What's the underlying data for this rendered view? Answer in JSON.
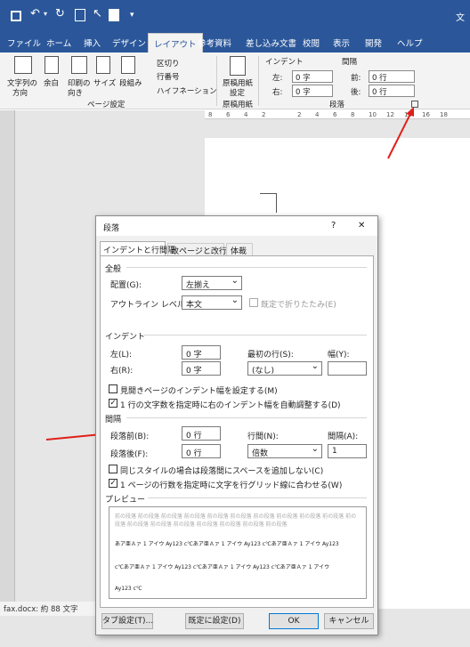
{
  "titlebar": {
    "doc_title_partial": "文"
  },
  "tabs": [
    {
      "label": "ファイル"
    },
    {
      "label": "ホーム"
    },
    {
      "label": "挿入"
    },
    {
      "label": "デザイン"
    },
    {
      "label": "レイアウト"
    },
    {
      "label": "参考資料"
    },
    {
      "label": "差し込み文書"
    },
    {
      "label": "校閲"
    },
    {
      "label": "表示"
    },
    {
      "label": "開発"
    },
    {
      "label": "ヘルプ"
    }
  ],
  "ribbon": {
    "text_direction_l1": "文字列の",
    "text_direction_l2": "方向",
    "margins": "余白",
    "orientation_l1": "印刷の",
    "orientation_l2": "向き",
    "size": "サイズ",
    "columns": "段組み",
    "breaks": "区切り",
    "line_numbers": "行番号",
    "hyphenation": "ハイフネーション",
    "page_setup_group": "ページ設定",
    "manuscript_l1": "原稿用紙",
    "manuscript_l2": "設定",
    "manuscript_group": "原稿用紙",
    "indent_header": "インデント",
    "indent_left_label": "左:",
    "indent_left_value": "0 字",
    "indent_right_label": "右:",
    "indent_right_value": "0 字",
    "spacing_header": "間隔",
    "spacing_before_label": "前:",
    "spacing_before_value": "0 行",
    "spacing_after_label": "後:",
    "spacing_after_value": "0 行",
    "paragraph_group": "段落"
  },
  "ruler_ticks": [
    "8",
    "6",
    "4",
    "2",
    "",
    "2",
    "4",
    "6",
    "8",
    "10",
    "12",
    "14",
    "16",
    "18"
  ],
  "status": "fax.docx: 約 88 文字",
  "dialog": {
    "title": "段落",
    "help": "?",
    "close": "✕",
    "tabs": [
      "インデントと行間隔",
      "改ページと改行",
      "体裁"
    ],
    "general_section": "全般",
    "alignment_label": "配置(G):",
    "alignment_value": "左揃え",
    "outline_label": "アウトライン レベル(O):",
    "outline_value": "本文",
    "collapsed_label": "既定で折りたたみ(E)",
    "indent_section": "インデント",
    "left_label": "左(L):",
    "left_value": "0 字",
    "right_label": "右(R):",
    "right_value": "0 字",
    "first_line_label": "最初の行(S):",
    "first_line_value": "(なし)",
    "width_label": "幅(Y):",
    "width_value": "",
    "mirror_label": "見開きページのインデント幅を設定する(M)",
    "auto_adjust_label": "1 行の文字数を指定時に右のインデント幅を自動調整する(D)",
    "spacing_section": "間隔",
    "before_label": "段落前(B):",
    "before_value": "0 行",
    "after_label": "段落後(F):",
    "after_value": "0 行",
    "line_spacing_label": "行間(N):",
    "line_spacing_value": "倍数",
    "at_label": "間隔(A):",
    "at_value": "1",
    "same_style_label": "同じスタイルの場合は段落間にスペースを追加しない(C)",
    "grid_label": "1 ページの行数を指定時に文字を行グリッド線に合わせる(W)",
    "preview_section": "プレビュー",
    "preview_prev": "前の段落 前の段落 前の段落 前の段落 前の段落 前の段落 前の段落 前の段落 前の段落 前の段落 前の段落 前の段落 前の段落 前の段落 前の段落 前の段落 前の段落 前の段落",
    "preview_line1": "あア亜Ａァ 1 アイウ Ay123 c℃あア亜Ａァ 1 アイウ Ay123 c℃あア亜Ａァ 1 アイウ Ay123",
    "preview_line2": "c℃あア亜Ａァ 1 アイウ Ay123 c℃あア亜Ａァ 1 アイウ Ay123 c℃あア亜Ａァ 1 アイウ",
    "preview_line3": "Ay123 c℃",
    "tabs_button": "タブ設定(T)...",
    "default_button": "既定に設定(D)",
    "ok_button": "OK",
    "cancel_button": "キャンセル"
  },
  "colors": {
    "ribbon_blue": "#2b579a",
    "arrow_red": "#e0201a"
  }
}
